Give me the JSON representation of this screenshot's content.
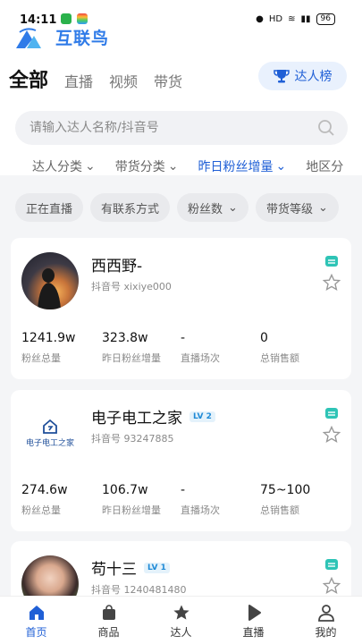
{
  "status": {
    "time": "14:11",
    "battery": "96"
  },
  "app": {
    "logo_text": "互联鸟"
  },
  "tabs": [
    {
      "label": "全部"
    },
    {
      "label": "直播"
    },
    {
      "label": "视频"
    },
    {
      "label": "带货"
    }
  ],
  "rank_button": {
    "label": "达人榜"
  },
  "search": {
    "placeholder": "请输入达人名称/抖音号"
  },
  "filters": [
    {
      "label": "达人分类"
    },
    {
      "label": "带货分类"
    },
    {
      "label": "昨日粉丝增量"
    },
    {
      "label": "地区分"
    }
  ],
  "chips": [
    {
      "label": "正在直播"
    },
    {
      "label": "有联系方式"
    },
    {
      "label": "粉丝数"
    },
    {
      "label": "带货等级"
    }
  ],
  "cards": [
    {
      "name": "西西野-",
      "level": "",
      "douyin": "抖音号 xixiye000",
      "stats": [
        {
          "value": "1241.9w",
          "label": "粉丝总量"
        },
        {
          "value": "323.8w",
          "label": "昨日粉丝增量"
        },
        {
          "value": "-",
          "label": "直播场次"
        },
        {
          "value": "0",
          "label": "总销售额"
        }
      ]
    },
    {
      "name": "电子电工之家",
      "level": "LV 2",
      "avatar_text": "电子电工之家",
      "douyin": "抖音号 93247885",
      "stats": [
        {
          "value": "274.6w",
          "label": "粉丝总量"
        },
        {
          "value": "106.7w",
          "label": "昨日粉丝增量"
        },
        {
          "value": "-",
          "label": "直播场次"
        },
        {
          "value": "75~100",
          "label": "总销售额"
        }
      ]
    },
    {
      "name": "苟十三",
      "level": "LV 1",
      "douyin": "抖音号 1240481480"
    }
  ],
  "bottom_nav": [
    {
      "label": "首页",
      "icon": "home-icon"
    },
    {
      "label": "商品",
      "icon": "bag-icon"
    },
    {
      "label": "达人",
      "icon": "star-icon"
    },
    {
      "label": "直播",
      "icon": "play-icon"
    },
    {
      "label": "我的",
      "icon": "user-icon"
    }
  ],
  "colors": {
    "accent": "#1f5fd6",
    "brand": "#2f7be8",
    "teal": "#2ec4b6"
  }
}
